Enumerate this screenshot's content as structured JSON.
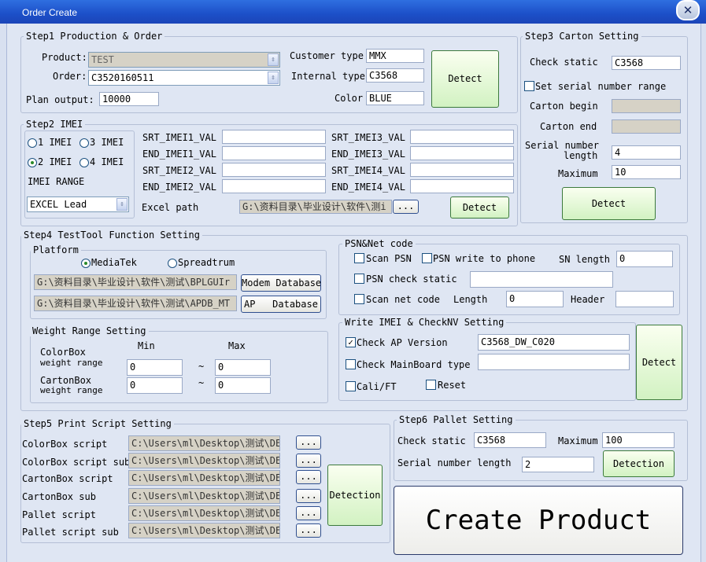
{
  "window": {
    "title": "Order Create",
    "close_glyph": "✕"
  },
  "step1": {
    "title": "Step1 Production & Order",
    "product_label": "Product:",
    "product_value": "TEST",
    "order_label": "Order:",
    "order_value": "C3520160511",
    "plan_label": "Plan output:",
    "plan_value": "10000",
    "customer_type_label": "Customer type",
    "customer_type_value": "MMX",
    "internal_type_label": "Internal type",
    "internal_type_value": "C3568",
    "color_label": "Color",
    "color_value": "BLUE",
    "detect_label": "Detect"
  },
  "step2": {
    "title": "Step2 IMEI",
    "imei_options": [
      "1 IMEI",
      "3 IMEI",
      "2 IMEI",
      "4 IMEI"
    ],
    "selected_option": "2 IMEI",
    "range_label": "IMEI RANGE",
    "range_value": "EXCEL Lead",
    "fields": [
      "SRT_IMEI1_VAL",
      "END_IMEI1_VAL",
      "SRT_IMEI2_VAL",
      "END_IMEI2_VAL",
      "SRT_IMEI3_VAL",
      "END_IMEI3_VAL",
      "SRT_IMEI4_VAL",
      "END_IMEI4_VAL"
    ],
    "excel_label": "Excel path",
    "excel_value": "G:\\资料目录\\毕业设计\\软件\\测i",
    "browse_label": "...",
    "detect_label": "Detect"
  },
  "step3": {
    "title": "Step3 Carton Setting",
    "check_static_label": "Check static",
    "check_static_value": "C3568",
    "set_serial_label": "Set serial number range",
    "carton_begin_label": "Carton begin",
    "carton_end_label": "Carton end",
    "serial_len_label_1": "Serial number",
    "serial_len_label_2": "length",
    "serial_len_value": "4",
    "maximum_label": "Maximum",
    "maximum_value": "10",
    "detect_label": "Detect"
  },
  "step4": {
    "title": "Step4 TestTool Function Setting",
    "platform_title": "Platform",
    "mediatek_label": "MediaTek",
    "spreadtrum_label": "Spreadtrum",
    "modem_path": "G:\\资料目录\\毕业设计\\软件\\测试\\BPLGUIr",
    "modem_btn": "Modem Database",
    "ap_path": "G:\\资料目录\\毕业设计\\软件\\测试\\APDB_MT",
    "ap_btn": "AP   Database",
    "weight_title": "Weight Range Setting",
    "min_label": "Min",
    "max_label": "Max",
    "colorbox_label_1": "ColorBox",
    "colorbox_label_2": "weight range",
    "colorbox_min": "0",
    "colorbox_max": "0",
    "cartonbox_label_1": "CartonBox",
    "cartonbox_label_2": "weight range",
    "cartonbox_min": "0",
    "cartonbox_max": "0",
    "tilde": "~",
    "psn": {
      "title": "PSN&Net code",
      "scan_psn_label": "Scan PSN",
      "psn_write_label": "PSN write to phone",
      "sn_length_label": "SN length",
      "sn_length_value": "0",
      "psn_check_label": "PSN check static",
      "scan_net_label": "Scan net code",
      "length_label": "Length",
      "length_value": "0",
      "header_label": "Header"
    },
    "write_imei": {
      "title": "Write IMEI & CheckNV Setting",
      "check_ap_label": "Check AP Version",
      "check_ap_value": "C3568_DW_C020",
      "check_mainboard_label": "Check MainBoard type",
      "cali_label": "Cali/FT",
      "reset_label": "Reset",
      "detect_label": "Detect"
    }
  },
  "step5": {
    "title": "Step5 Print Script Setting",
    "scripts": [
      {
        "label": "ColorBox script",
        "path": "C:\\Users\\ml\\Desktop\\测试\\DE"
      },
      {
        "label": "ColorBox script sub",
        "path": "C:\\Users\\ml\\Desktop\\测试\\DE"
      },
      {
        "label": "CartonBox script",
        "path": "C:\\Users\\ml\\Desktop\\测试\\DE"
      },
      {
        "label": "CartonBox sub",
        "path": "C:\\Users\\ml\\Desktop\\测试\\DE"
      },
      {
        "label": "Pallet script",
        "path": "C:\\Users\\ml\\Desktop\\测试\\DE"
      },
      {
        "label": "Pallet script sub",
        "path": "C:\\Users\\ml\\Desktop\\测试\\DE"
      }
    ],
    "browse_label": "...",
    "detection_label": "Detection"
  },
  "step6": {
    "title": "Step6 Pallet Setting",
    "check_static_label": "Check static",
    "check_static_value": "C3568",
    "maximum_label": "Maximum",
    "maximum_value": "100",
    "serial_len_label": "Serial number length",
    "serial_len_value": "2",
    "detection_label": "Detection"
  },
  "create_label": "Create Product"
}
